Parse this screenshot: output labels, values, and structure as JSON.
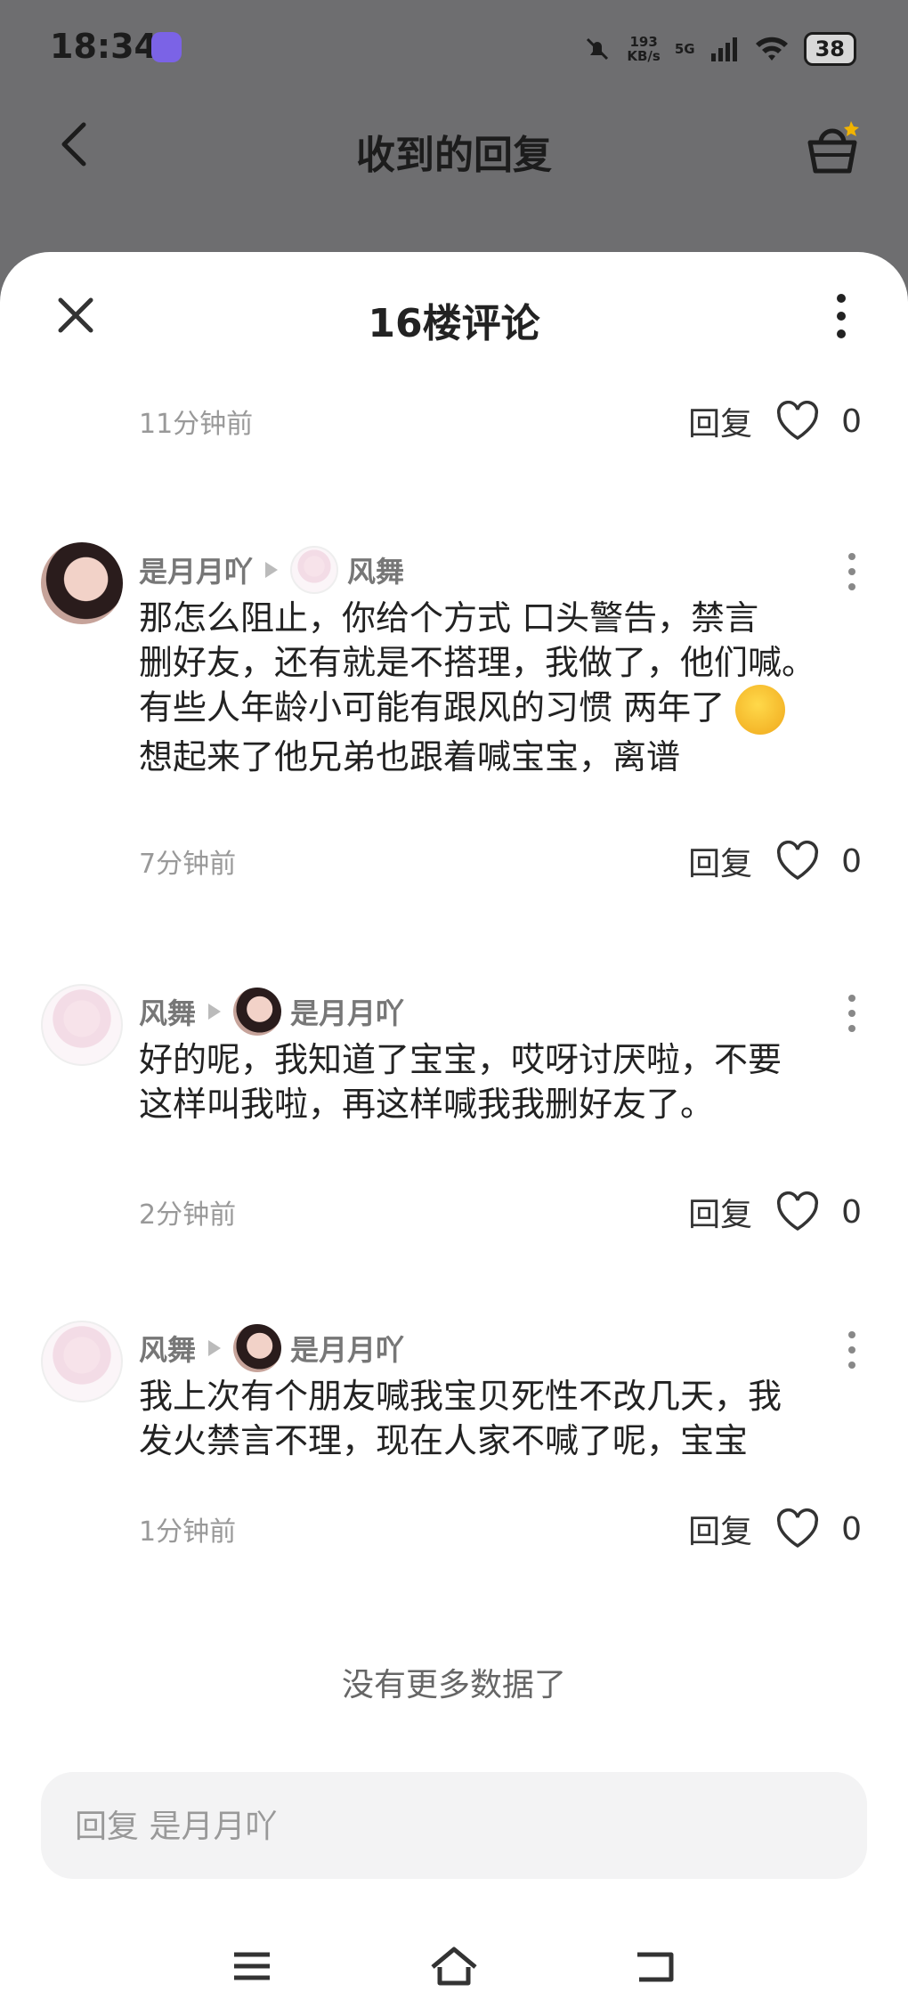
{
  "status": {
    "time": "18:34",
    "speed": "193",
    "speed_unit": "KB/s",
    "network": "5G",
    "battery": "38"
  },
  "topbar": {
    "title": "收到的回复"
  },
  "sheet": {
    "title": "16楼评论"
  },
  "first_meta": {
    "time": "11分钟前",
    "reply": "回复",
    "likes": "0"
  },
  "comments": [
    {
      "author": "是月月吖",
      "reply_to": "风舞",
      "lines": [
        "那怎么阻止，你给个方式 口头警告，禁言",
        "删好友，还有就是不搭理，我做了，他们喊。",
        "有些人年龄小可能有跟风的习惯 两年了",
        "想起来了他兄弟也跟着喊宝宝，离谱"
      ],
      "time": "7分钟前",
      "reply": "回复",
      "likes": "0"
    },
    {
      "author": "风舞",
      "reply_to": "是月月吖",
      "lines": [
        "好的呢，我知道了宝宝，哎呀讨厌啦，不要",
        "这样叫我啦，再这样喊我我删好友了。"
      ],
      "time": "2分钟前",
      "reply": "回复",
      "likes": "0"
    },
    {
      "author": "风舞",
      "reply_to": "是月月吖",
      "lines": [
        "我上次有个朋友喊我宝贝死性不改几天，我",
        "发火禁言不理，现在人家不喊了呢，宝宝"
      ],
      "time": "1分钟前",
      "reply": "回复",
      "likes": "0"
    }
  ],
  "footer": {
    "end_text": "没有更多数据了",
    "reply_placeholder": "回复 是月月吖"
  }
}
